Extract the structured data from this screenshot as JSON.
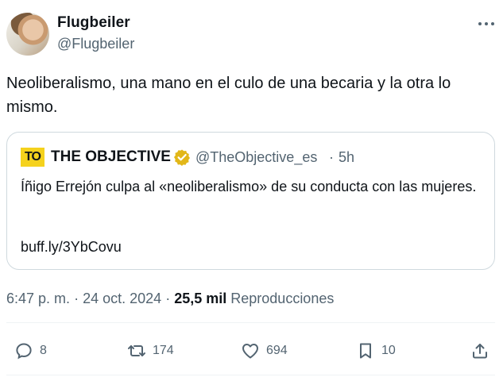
{
  "author": {
    "name": "Flugbeiler",
    "handle": "@Flugbeiler",
    "more_icon": "more-horizontal-icon"
  },
  "tweet": {
    "text": "Neoliberalismo, una mano en el culo de una becaria y la otra lo mismo."
  },
  "quote": {
    "logo_text": "TO",
    "name": "THE OBJECTIVE",
    "verified_icon": "verified-badge-icon",
    "handle": "@TheObjective_es",
    "separator": "·",
    "time": "5h",
    "text": "Íñigo Errejón culpa al «neoliberalismo» de su conducta con las mujeres.",
    "link": "buff.ly/3YbCovu"
  },
  "meta": {
    "time": "6:47 p. m.",
    "sep1": "·",
    "date": "24 oct. 2024",
    "sep2": "·",
    "views": "25,5 mil",
    "views_label": "Reproducciones"
  },
  "actions": {
    "replies": "8",
    "reposts": "174",
    "likes": "694",
    "bookmarks": "10"
  },
  "colors": {
    "text": "#0f1419",
    "secondary": "#536471",
    "border": "#cfd9de",
    "verified_gold": "#e2b719",
    "logo_yellow": "#f5d21d"
  }
}
